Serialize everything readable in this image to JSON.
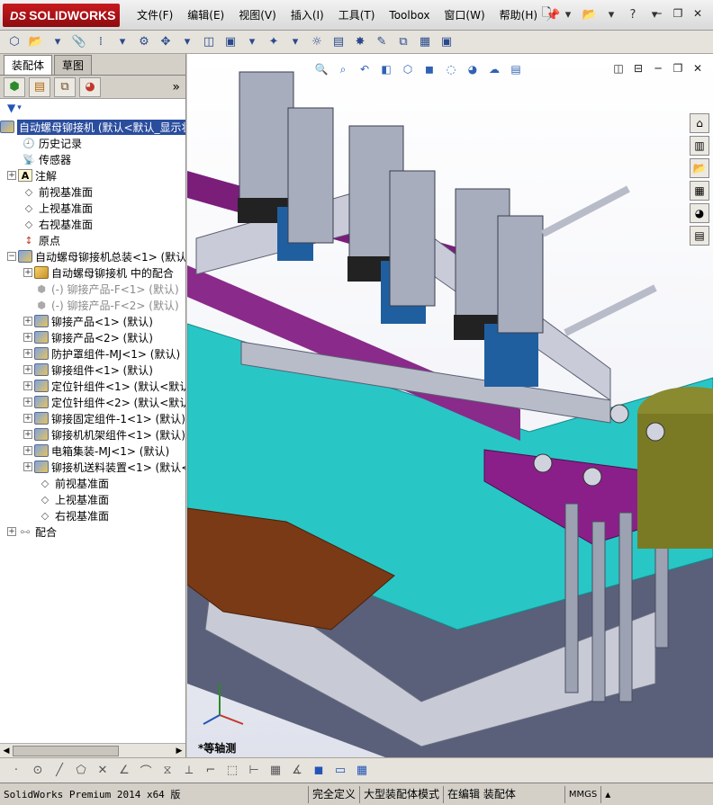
{
  "app": {
    "logo_ds": "DS",
    "logo_text": "SOLIDWORKS"
  },
  "menu": [
    "文件(F)",
    "编辑(E)",
    "视图(V)",
    "插入(I)",
    "工具(T)",
    "Toolbox",
    "窗口(W)",
    "帮助(H)"
  ],
  "panel": {
    "tabs": [
      "装配体",
      "草图"
    ],
    "more_glyph": "»"
  },
  "tree": [
    {
      "label": "自动螺母铆接机  (默认<默认_显示状态",
      "icon": "asm",
      "selected": true
    },
    {
      "label": "历史记录",
      "icon": "history"
    },
    {
      "label": "传感器",
      "icon": "sensor"
    },
    {
      "label": "注解",
      "icon": "annotation"
    },
    {
      "label": "前视基准面",
      "icon": "plane"
    },
    {
      "label": "上视基准面",
      "icon": "plane"
    },
    {
      "label": "右视基准面",
      "icon": "plane"
    },
    {
      "label": "原点",
      "icon": "origin"
    },
    {
      "label": "自动螺母铆接机总装<1> (默认<",
      "icon": "asm"
    },
    {
      "label": "自动螺母铆接机 中的配合",
      "icon": "mates"
    },
    {
      "label": "(-) 铆接产品-F<1> (默认)",
      "icon": "part-grey"
    },
    {
      "label": "(-) 铆接产品-F<2> (默认)",
      "icon": "part-grey"
    },
    {
      "label": "铆接产品<1> (默认)",
      "icon": "asm"
    },
    {
      "label": "铆接产品<2> (默认)",
      "icon": "asm"
    },
    {
      "label": "防护罩组件-MJ<1> (默认)",
      "icon": "asm"
    },
    {
      "label": "铆接组件<1> (默认)",
      "icon": "asm"
    },
    {
      "label": "定位针组件<1> (默认<默认",
      "icon": "asm"
    },
    {
      "label": "定位针组件<2> (默认<默认",
      "icon": "asm"
    },
    {
      "label": "铆接固定组件-1<1> (默认)",
      "icon": "asm"
    },
    {
      "label": "铆接机机架组件<1> (默认)",
      "icon": "asm"
    },
    {
      "label": "电箱集装-MJ<1> (默认)",
      "icon": "asm"
    },
    {
      "label": "铆接机送料装置<1> (默认<",
      "icon": "asm"
    },
    {
      "label": "前视基准面",
      "icon": "plane"
    },
    {
      "label": "上视基准面",
      "icon": "plane"
    },
    {
      "label": "右视基准面",
      "icon": "plane"
    },
    {
      "label": "配合",
      "icon": "mates2"
    }
  ],
  "viewport": {
    "view_label": "*等轴测"
  },
  "status": {
    "product": "SolidWorks Premium 2014 x64 版",
    "cells": [
      "完全定义",
      "大型装配体模式",
      "在编辑 装配体"
    ],
    "units": "MMGS"
  }
}
